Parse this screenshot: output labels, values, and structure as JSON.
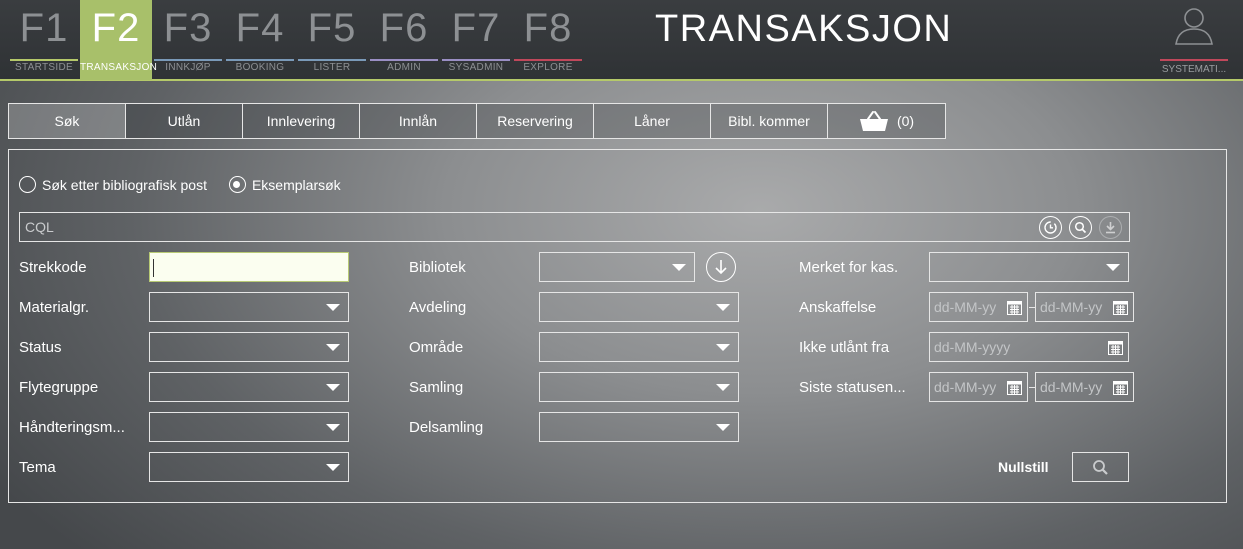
{
  "nav": {
    "keys": [
      {
        "key": "F1",
        "label": "STARTSIDE",
        "line_color": "#b5c96a"
      },
      {
        "key": "F2",
        "label": "TRANSAKSJON",
        "line_color": "#b5c96a",
        "active": true
      },
      {
        "key": "F3",
        "label": "INNKJØP",
        "line_color": "#7a9ab8"
      },
      {
        "key": "F4",
        "label": "BOOKING",
        "line_color": "#7a9ab8"
      },
      {
        "key": "F5",
        "label": "LISTER",
        "line_color": "#7a9ab8"
      },
      {
        "key": "F6",
        "label": "ADMIN",
        "line_color": "#9a8fc4"
      },
      {
        "key": "F7",
        "label": "SYSADMIN",
        "line_color": "#9a8fc4"
      },
      {
        "key": "F8",
        "label": "EXPLORE",
        "line_color": "#c0485b"
      }
    ],
    "page_title": "TRANSAKSJON",
    "user_label": "SYSTEMATI...",
    "active_color": "#a8c06a"
  },
  "tabs": {
    "items": [
      "Søk",
      "Utlån",
      "Innlevering",
      "Innlån",
      "Reservering",
      "Låner",
      "Bibl. kommer"
    ],
    "basket_count": "(0)"
  },
  "search": {
    "radio_bibliographic": "Søk etter bibliografisk post",
    "radio_copy": "Eksemplarsøk",
    "cql_placeholder": "CQL"
  },
  "fields": {
    "col1": [
      "Strekkode",
      "Materialgr.",
      "Status",
      "Flytegruppe",
      "Håndteringsm...",
      "Tema"
    ],
    "col2": [
      "Bibliotek",
      "Avdeling",
      "Område",
      "Samling",
      "Delsamling"
    ],
    "col3": [
      "Merket for kas.",
      "Anskaffelse",
      "Ikke utlånt fra",
      "Siste statusen..."
    ],
    "date_placeholder_short": "dd-MM-yy",
    "date_placeholder_full": "dd-MM-yyyy"
  },
  "actions": {
    "reset_label": "Nullstill"
  }
}
